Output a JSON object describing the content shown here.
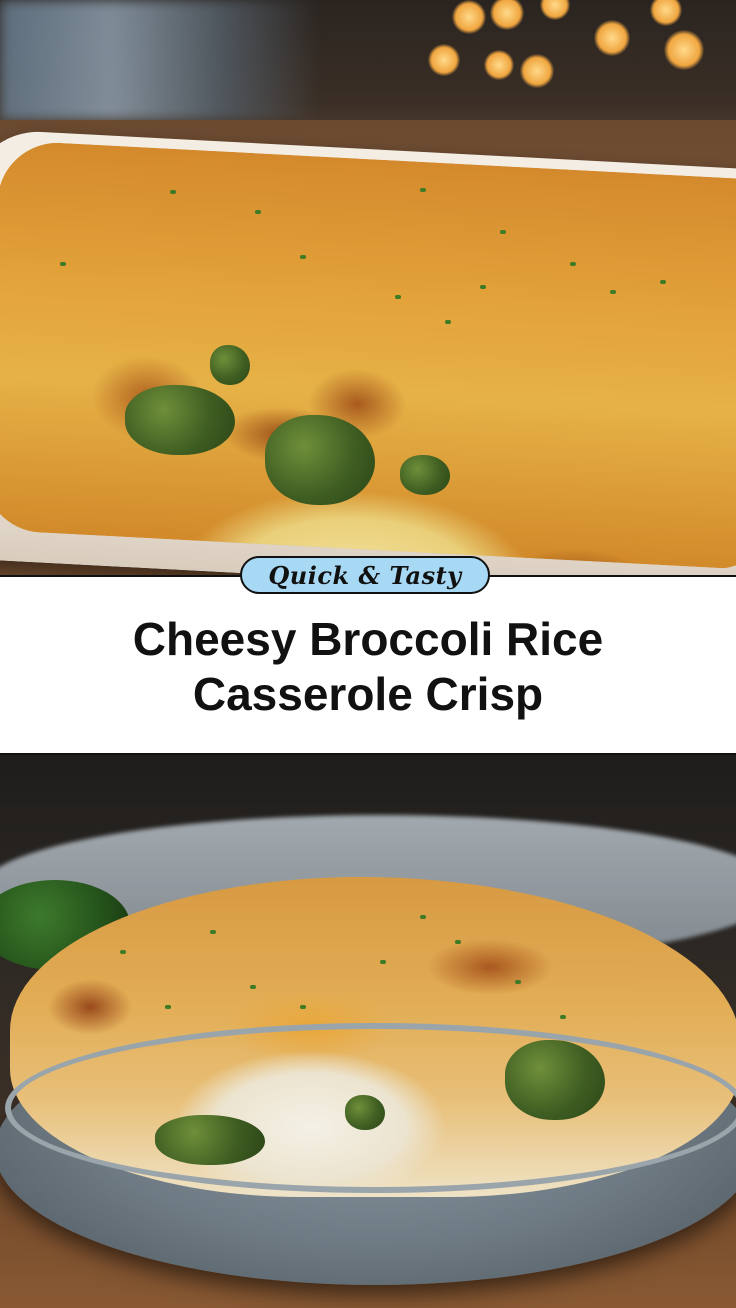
{
  "badge": {
    "label": "Quick & Tasty",
    "background": "#a7d9f5"
  },
  "title": {
    "line1": "Cheesy Broccoli Rice",
    "line2": "Casserole Crisp"
  },
  "colors": {
    "band_background": "#ffffff",
    "text": "#111111",
    "border": "#111111"
  }
}
